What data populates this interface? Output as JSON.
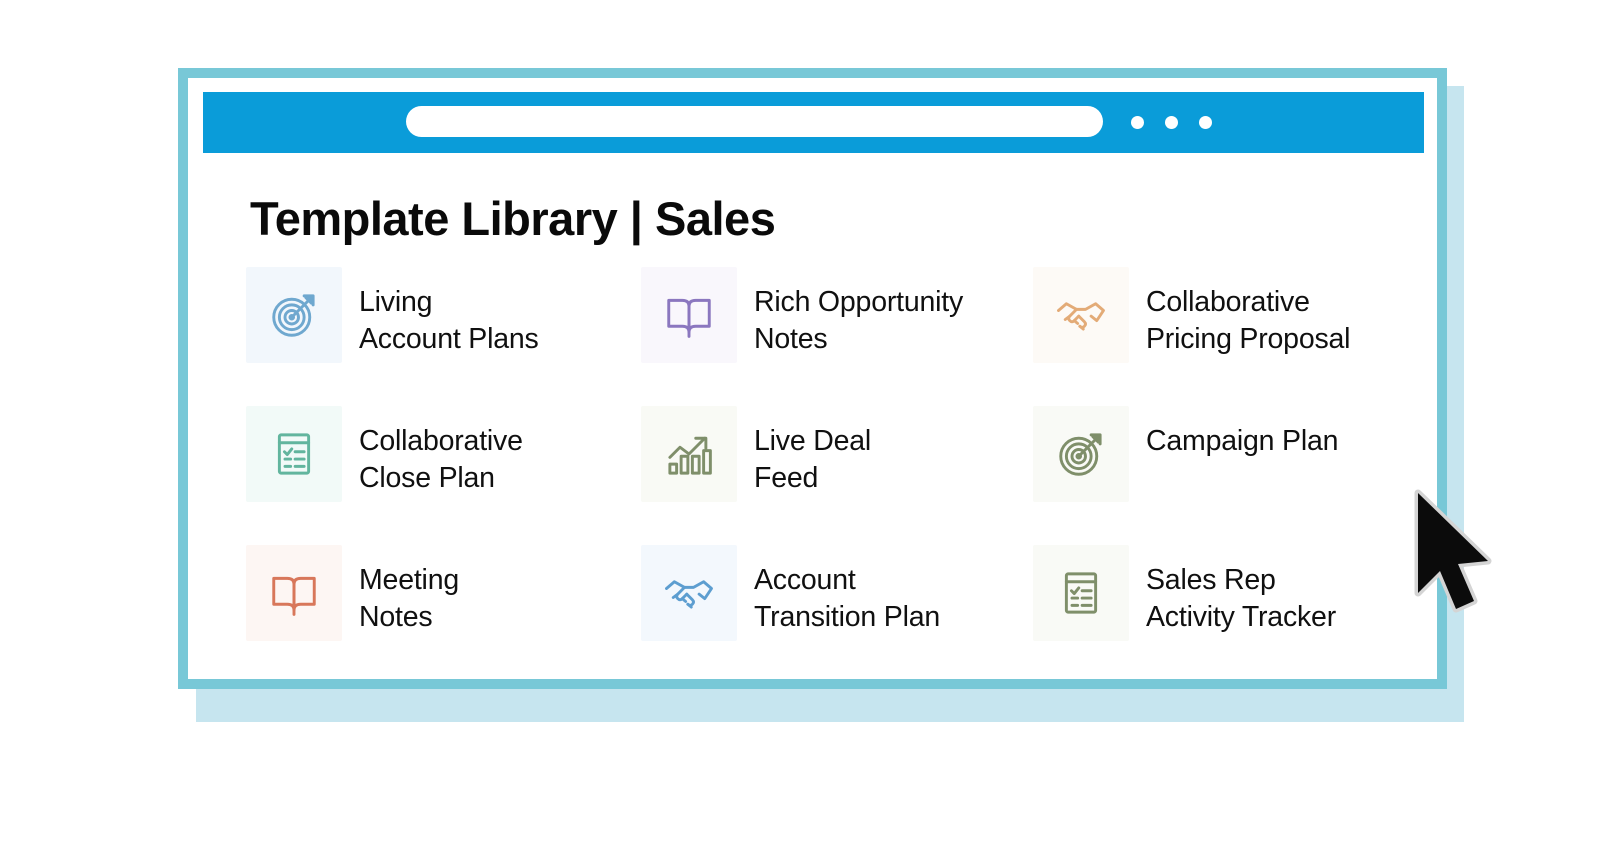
{
  "window": {
    "border_color": "#78c8d7",
    "shadow_color": "#c6e5ef",
    "chrome_color": "#0a9cd9",
    "url_value": "",
    "url_placeholder": "",
    "menu_dots": [
      "dot",
      "dot",
      "dot"
    ]
  },
  "page": {
    "title": "Template Library | Sales"
  },
  "templates": [
    {
      "label": "Living\nAccount Plans",
      "icon": "target-icon",
      "icon_color": "#6fa8cf",
      "tile_color": "#f2f7fc"
    },
    {
      "label": "Rich Opportunity\nNotes",
      "icon": "open-book-icon",
      "icon_color": "#8b77bf",
      "tile_color": "#f9f7fc"
    },
    {
      "label": "Collaborative\nPricing Proposal",
      "icon": "handshake-icon",
      "icon_color": "#e3ab77",
      "tile_color": "#fdfaf6"
    },
    {
      "label": "Collaborative\nClose Plan",
      "icon": "checklist-icon",
      "icon_color": "#62b59e",
      "tile_color": "#f2faf8"
    },
    {
      "label": "Live Deal\nFeed",
      "icon": "growth-chart-icon",
      "icon_color": "#7f8f6a",
      "tile_color": "#f9faf5"
    },
    {
      "label": "Campaign Plan",
      "icon": "target-icon",
      "icon_color": "#7f8f6a",
      "tile_color": "#f9faf6"
    },
    {
      "label": "Meeting\nNotes",
      "icon": "open-book-icon",
      "icon_color": "#d8775a",
      "tile_color": "#fdf6f3"
    },
    {
      "label": "Account\nTransition Plan",
      "icon": "handshake-icon",
      "icon_color": "#5d9ed0",
      "tile_color": "#f3f8fd"
    },
    {
      "label": "Sales Rep\nActivity Tracker",
      "icon": "checklist-icon",
      "icon_color": "#7f8f6a",
      "tile_color": "#f9faf6"
    }
  ],
  "cursor": {
    "icon": "mouse-pointer-icon"
  }
}
